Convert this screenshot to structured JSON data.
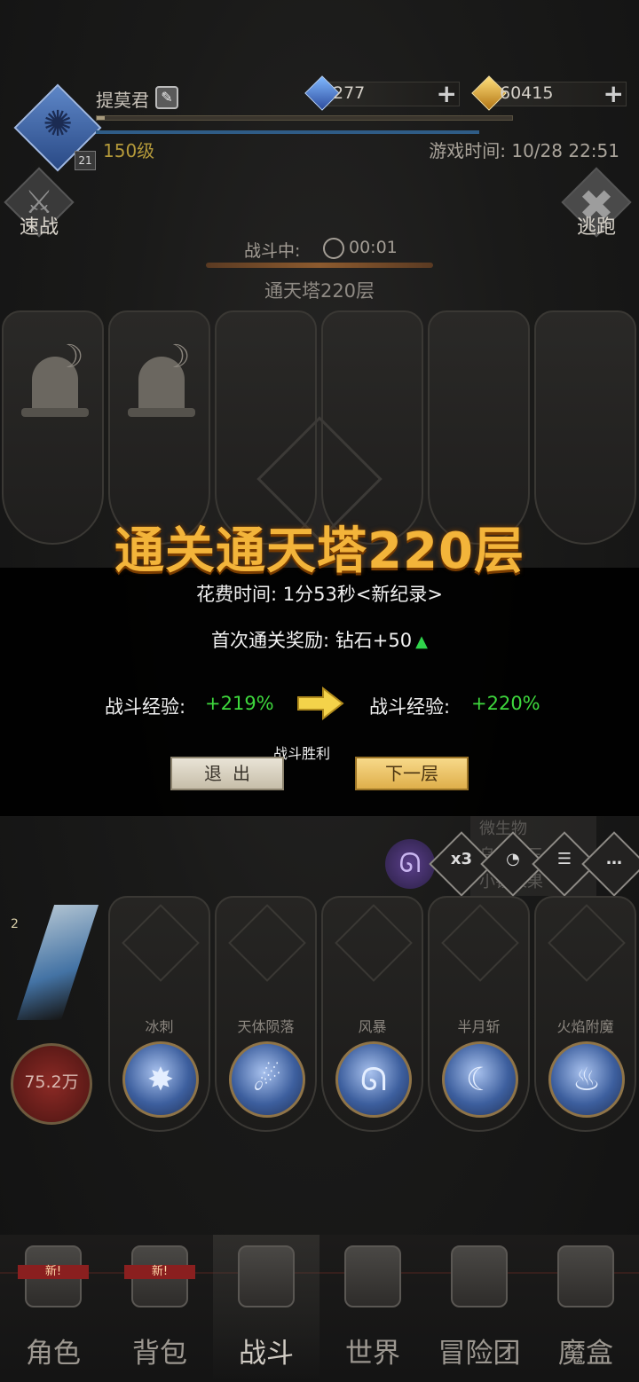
{
  "header": {
    "player_name": "提莫君",
    "level_badge": "21",
    "level_text": "150级",
    "play_time": "游戏时间: 10/28 22:51",
    "exp_fraction": 0.02,
    "currencies": {
      "diamond": "277",
      "gold": "60415"
    }
  },
  "side_buttons": {
    "quick_battle": "速战",
    "escape": "逃跑"
  },
  "battle": {
    "status_label": "战斗中:",
    "timer": "00:01",
    "floor": "通天塔220层"
  },
  "victory": {
    "title": "通关通天塔220层",
    "time_line": "花费时间:   1分53秒<新纪录>",
    "reward_line": "首次通关奖励:  钻石+50",
    "exp_left_label": "战斗经验:",
    "exp_left_value": "+219%",
    "exp_right_label": "战斗经验:",
    "exp_right_value": "+220%",
    "caption": "战斗胜利",
    "exit_button": "退出",
    "next_button": "下一层"
  },
  "controls": {
    "speed": "x3",
    "chat_faded": [
      "微生物",
      "乌龟张三",
      "小钱果果"
    ]
  },
  "hero": {
    "hp": "75.2万",
    "count": "2"
  },
  "skills": [
    {
      "name": "冰刺",
      "glyph": "✸"
    },
    {
      "name": "天体陨落",
      "glyph": "☄"
    },
    {
      "name": "风暴",
      "glyph": "ᘏ"
    },
    {
      "name": "半月斩",
      "glyph": "☾"
    },
    {
      "name": "火焰附魔",
      "glyph": "♨"
    }
  ],
  "nav": [
    {
      "label": "角色",
      "badge": "新!"
    },
    {
      "label": "背包",
      "badge": "新!"
    },
    {
      "label": "战斗",
      "badge": ""
    },
    {
      "label": "世界",
      "badge": ""
    },
    {
      "label": "冒险团",
      "badge": ""
    },
    {
      "label": "魔盒",
      "badge": ""
    }
  ],
  "colors": {
    "gold_title": "#f3b43a",
    "exp_green": "#3ed83d",
    "panel_bg": "#000000"
  }
}
